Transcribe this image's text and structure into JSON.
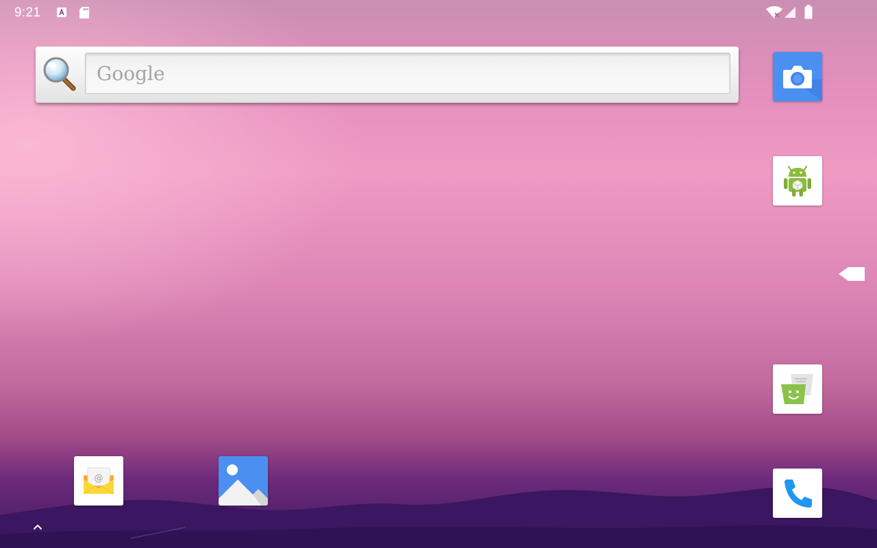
{
  "status_bar": {
    "time": "9:21",
    "left_icons": [
      "text-a-notification-icon",
      "sd-card-icon"
    ],
    "right_icons": [
      "wifi-no-internet-icon",
      "cell-signal-icon",
      "battery-icon"
    ]
  },
  "search_widget": {
    "placeholder": "Google",
    "icon": "magnifier-icon"
  },
  "hotseat_right": [
    {
      "id": "camera",
      "icon": "camera-icon",
      "accent": "#4285f4"
    },
    {
      "id": "android-app",
      "icon": "android-robot-icon",
      "accent": "#8bc34a"
    },
    {
      "id": "messaging",
      "icon": "messaging-smiley-icon",
      "accent": "#8bc34a"
    },
    {
      "id": "phone",
      "icon": "phone-icon",
      "accent": "#2196f3"
    }
  ],
  "desktop_bottom": [
    {
      "id": "email",
      "icon": "email-envelope-icon",
      "accent": "#fbc02d"
    },
    {
      "id": "gallery",
      "icon": "gallery-photo-icon",
      "accent": "#4285f4"
    }
  ],
  "navigation": {
    "back_icon": "back-arrow-icon",
    "all_apps_icon": "chevron-up-icon"
  },
  "colors": {
    "wallpaper_top": "#e58fbd",
    "wallpaper_bottom": "#3d1a5e",
    "status_text": "#ffffff"
  }
}
